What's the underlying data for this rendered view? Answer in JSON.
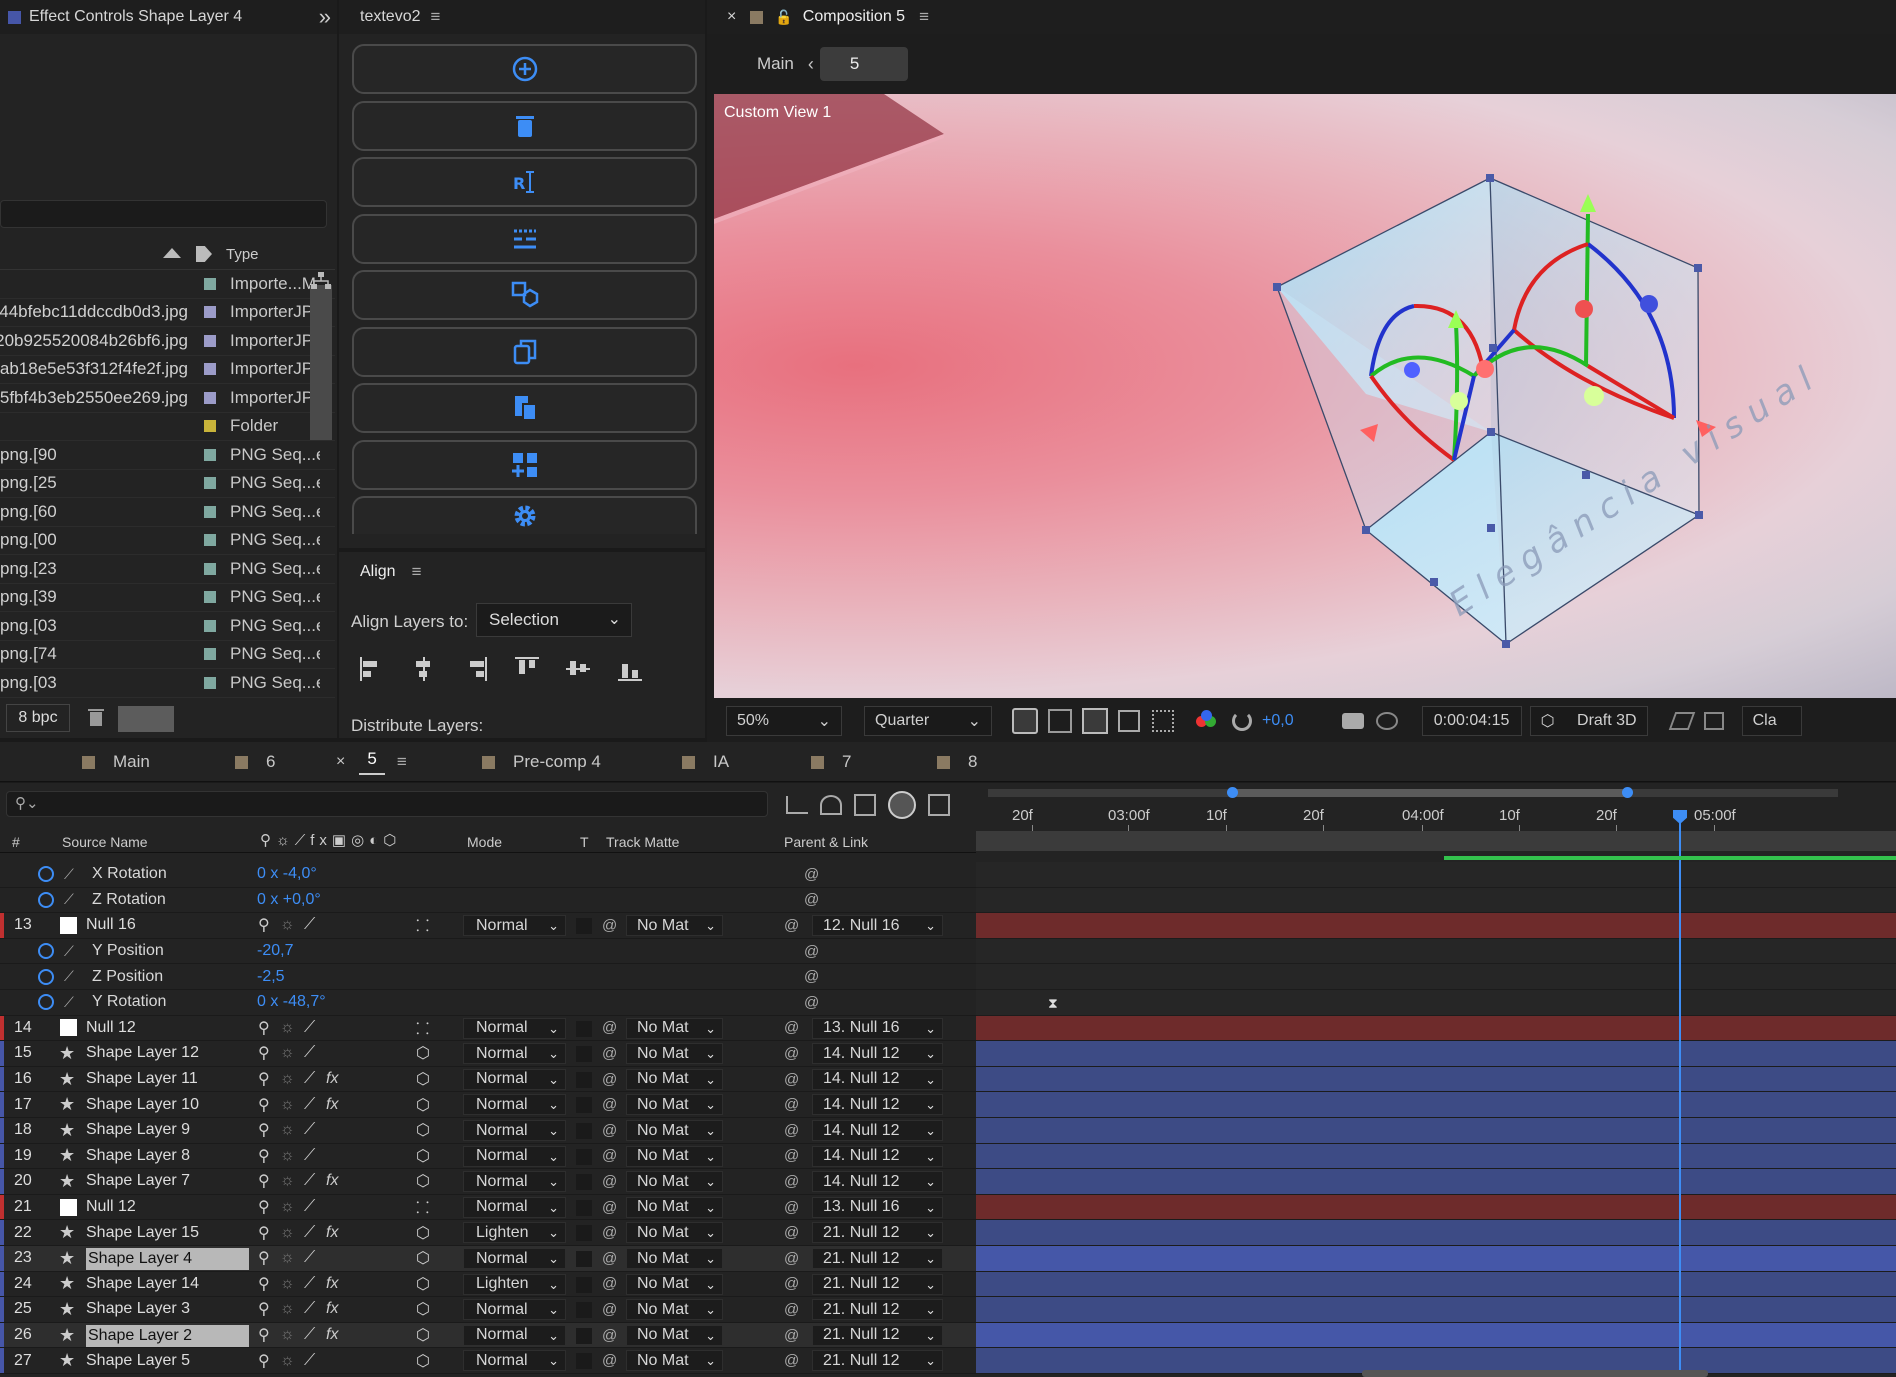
{
  "effect_controls": {
    "title": "Effect Controls Shape Layer 4",
    "expand": "»"
  },
  "project": {
    "header": {
      "type_label": "Type"
    },
    "items": [
      {
        "name": "",
        "type": "Importe...M",
        "color": "#7fa8a0"
      },
      {
        "name": "44bfebc11ddccdb0d3.jpg",
        "type": "ImporterJP",
        "color": "#9b9bc8"
      },
      {
        "name": "20b925520084b26bf6.jpg",
        "type": "ImporterJP",
        "color": "#9b9bc8"
      },
      {
        "name": "ab18e5e53f312f4fe2f.jpg",
        "type": "ImporterJP",
        "color": "#9b9bc8"
      },
      {
        "name": "5fbf4b3eb2550ee269.jpg",
        "type": "ImporterJP",
        "color": "#9b9bc8"
      },
      {
        "name": "",
        "type": "Folder",
        "color": "#c9b43a"
      },
      {
        "name": "90].png",
        "type": "PNG Seq...e",
        "color": "#7fa8a0"
      },
      {
        "name": "25].png",
        "type": "PNG Seq...e",
        "color": "#7fa8a0"
      },
      {
        "name": "60].png",
        "type": "PNG Seq...e",
        "color": "#7fa8a0"
      },
      {
        "name": "00].png",
        "type": "PNG Seq...e",
        "color": "#7fa8a0"
      },
      {
        "name": "23].png",
        "type": "PNG Seq...e",
        "color": "#7fa8a0"
      },
      {
        "name": "39].png",
        "type": "PNG Seq...e",
        "color": "#7fa8a0"
      },
      {
        "name": "03].png",
        "type": "PNG Seq...e",
        "color": "#7fa8a0"
      },
      {
        "name": "74].png",
        "type": "PNG Seq...e",
        "color": "#7fa8a0"
      },
      {
        "name": "03].png",
        "type": "PNG Seq...e",
        "color": "#7fa8a0"
      }
    ],
    "bpc": "8 bpc"
  },
  "textevo": {
    "title": "textevo2",
    "buttons": [
      "add-icon",
      "trash-icon",
      "text-cursor-icon",
      "layers-text-icon",
      "cube-duplicate-icon",
      "copy-icon",
      "paste-icon",
      "grid-add-icon",
      "gear-icon"
    ]
  },
  "align": {
    "title": "Align",
    "align_to_label": "Align Layers to:",
    "align_to_value": "Selection",
    "distribute_label": "Distribute Layers:"
  },
  "composition": {
    "title": "Composition 5",
    "breadcrumb_main": "Main",
    "breadcrumb_current": "5",
    "view_label": "Custom View 1",
    "overlay_text": "Elegância visual",
    "toolbar": {
      "zoom": "50%",
      "resolution": "Quarter",
      "exposure": "+0,0",
      "timecode": "0:00:04:15",
      "renderer": "Draft 3D",
      "extra": "Cla"
    }
  },
  "timeline": {
    "tabs": [
      {
        "label": "Main",
        "color": "#8a7a62",
        "active": false
      },
      {
        "label": "6",
        "color": "#8a7a62",
        "active": false
      },
      {
        "label": "5",
        "color": "#8a7a62",
        "active": true
      },
      {
        "label": "Pre-comp 4",
        "color": "#8a7a62",
        "active": false
      },
      {
        "label": "IA",
        "color": "#8a7a62",
        "active": false
      },
      {
        "label": "7",
        "color": "#8a7a62",
        "active": false
      },
      {
        "label": "8",
        "color": "#8a7a62",
        "active": false
      }
    ],
    "columns": {
      "num": "#",
      "source": "Source Name",
      "mode": "Mode",
      "t": "T",
      "matte": "Track Matte",
      "parent": "Parent & Link"
    },
    "ruler": [
      "20f",
      "03:00f",
      "10f",
      "20f",
      "04:00f",
      "10f",
      "20f",
      "05:00f"
    ],
    "rows": [
      {
        "kind": "prop",
        "name": "X Rotation",
        "value": "0 x -4,0°"
      },
      {
        "kind": "prop",
        "name": "Z Rotation",
        "value": "0 x +0,0°"
      },
      {
        "kind": "layer",
        "num": "13",
        "name": "Null 16",
        "icon": "null",
        "mode": "Normal",
        "matte": "No Mat",
        "parent": "12. Null 16",
        "bar": "#6e2b2b",
        "label": "#c03030"
      },
      {
        "kind": "prop",
        "name": "Y Position",
        "value": "-20,7"
      },
      {
        "kind": "prop",
        "name": "Z Position",
        "value": "-2,5"
      },
      {
        "kind": "prop",
        "name": "Y Rotation",
        "value": "0 x -48,7°"
      },
      {
        "kind": "layer",
        "num": "14",
        "name": "Null 12",
        "icon": "null",
        "mode": "Normal",
        "matte": "No Mat",
        "parent": "13. Null 16",
        "bar": "#6e2b2b",
        "label": "#c03030"
      },
      {
        "kind": "layer",
        "num": "15",
        "name": "Shape Layer 12",
        "icon": "star",
        "mode": "Normal",
        "matte": "No Mat",
        "parent": "14. Null 12",
        "bar": "#3d4b85",
        "label": "#4656a8"
      },
      {
        "kind": "layer",
        "num": "16",
        "name": "Shape Layer 11",
        "icon": "star",
        "fx": true,
        "mode": "Normal",
        "matte": "No Mat",
        "parent": "14. Null 12",
        "bar": "#3d4b85",
        "label": "#4656a8"
      },
      {
        "kind": "layer",
        "num": "17",
        "name": "Shape Layer 10",
        "icon": "star",
        "fx": true,
        "mode": "Normal",
        "matte": "No Mat",
        "parent": "14. Null 12",
        "bar": "#3d4b85",
        "label": "#4656a8"
      },
      {
        "kind": "layer",
        "num": "18",
        "name": "Shape Layer 9",
        "icon": "star",
        "mode": "Normal",
        "matte": "No Mat",
        "parent": "14. Null 12",
        "bar": "#3d4b85",
        "label": "#4656a8"
      },
      {
        "kind": "layer",
        "num": "19",
        "name": "Shape Layer 8",
        "icon": "star",
        "mode": "Normal",
        "matte": "No Mat",
        "parent": "14. Null 12",
        "bar": "#3d4b85",
        "label": "#4656a8"
      },
      {
        "kind": "layer",
        "num": "20",
        "name": "Shape Layer 7",
        "icon": "star",
        "fx": true,
        "mode": "Normal",
        "matte": "No Mat",
        "parent": "14. Null 12",
        "bar": "#3d4b85",
        "label": "#4656a8"
      },
      {
        "kind": "layer",
        "num": "21",
        "name": "Null 12",
        "icon": "null",
        "mode": "Normal",
        "matte": "No Mat",
        "parent": "13. Null 16",
        "bar": "#6e2b2b",
        "label": "#c03030"
      },
      {
        "kind": "layer",
        "num": "22",
        "name": "Shape Layer 15",
        "icon": "star",
        "fx": true,
        "mode": "Lighten",
        "matte": "No Mat",
        "parent": "21. Null 12",
        "bar": "#3d4b85",
        "label": "#4656a8"
      },
      {
        "kind": "layer",
        "num": "23",
        "name": "Shape Layer 4",
        "icon": "star",
        "selected": true,
        "mode": "Normal",
        "matte": "No Mat",
        "parent": "21. Null 12",
        "bar": "#4557a8",
        "label": "#4656a8"
      },
      {
        "kind": "layer",
        "num": "24",
        "name": "Shape Layer 14",
        "icon": "star",
        "fx": true,
        "mode": "Lighten",
        "matte": "No Mat",
        "parent": "21. Null 12",
        "bar": "#3d4b85",
        "label": "#4656a8"
      },
      {
        "kind": "layer",
        "num": "25",
        "name": "Shape Layer 3",
        "icon": "star",
        "fx": true,
        "mode": "Normal",
        "matte": "No Mat",
        "parent": "21. Null 12",
        "bar": "#3d4b85",
        "label": "#4656a8"
      },
      {
        "kind": "layer",
        "num": "26",
        "name": "Shape Layer 2",
        "icon": "star",
        "fx": true,
        "selected": true,
        "mode": "Normal",
        "matte": "No Mat",
        "parent": "21. Null 12",
        "bar": "#4557a8",
        "label": "#4656a8"
      },
      {
        "kind": "layer",
        "num": "27",
        "name": "Shape Layer 5",
        "icon": "star",
        "mode": "Normal",
        "matte": "No Mat",
        "parent": "21. Null 12",
        "bar": "#3d4b85",
        "label": "#4656a8"
      }
    ]
  }
}
